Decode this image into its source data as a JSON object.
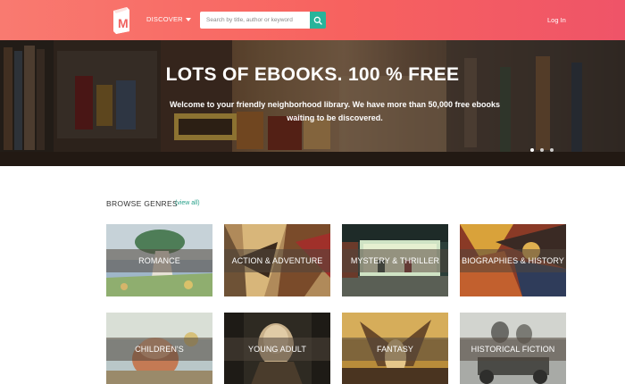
{
  "header": {
    "discover_label": "DISCOVER",
    "search_placeholder": "Search by title, author or keyword",
    "login_label": "Log In",
    "logo_letter": "M"
  },
  "hero": {
    "title": "LOTS OF EBOOKS. 100 % FREE",
    "subtitle": "Welcome to your friendly neighborhood library. We have more than 50,000 free ebooks waiting to be discovered.",
    "slide_count": 3,
    "active_slide": 1
  },
  "genres": {
    "section_title": "BROWSE GENRES",
    "view_all_label": "(view all)",
    "items": [
      {
        "label": "ROMANCE"
      },
      {
        "label": "ACTION & ADVENTURE"
      },
      {
        "label": "MYSTERY & THRILLER"
      },
      {
        "label": "BIOGRAPHIES & HISTORY"
      },
      {
        "label": "CHILDREN'S"
      },
      {
        "label": "YOUNG ADULT"
      },
      {
        "label": "FANTASY"
      },
      {
        "label": "HISTORICAL FICTION"
      }
    ]
  },
  "colors": {
    "header_start": "#f97a70",
    "header_end": "#ef5468",
    "accent_teal": "#27b49a",
    "link_green": "#27a08a"
  }
}
